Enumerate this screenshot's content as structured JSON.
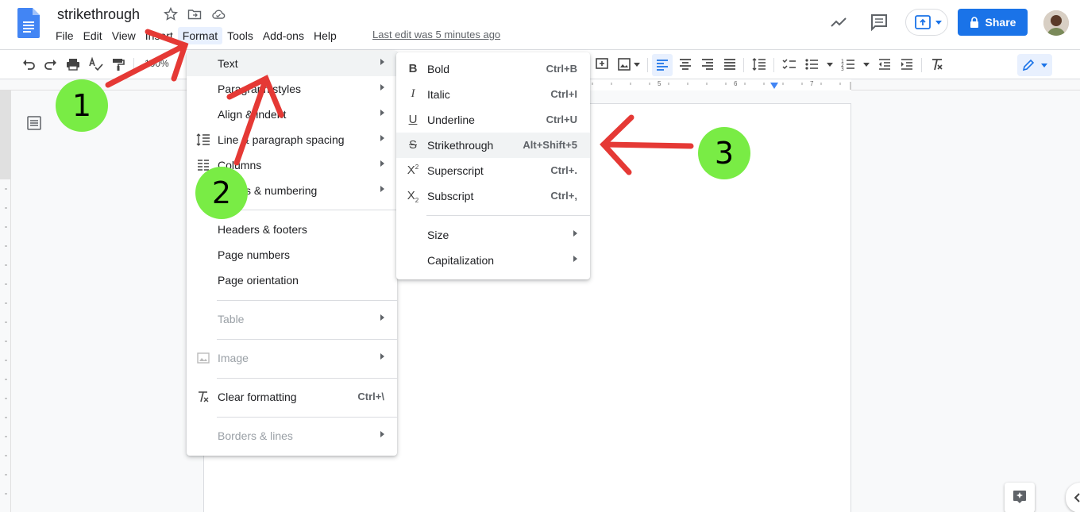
{
  "document": {
    "title": "strikethrough",
    "last_edit": "Last edit was 5 minutes ago"
  },
  "menubar": [
    "File",
    "Edit",
    "View",
    "Insert",
    "Format",
    "Tools",
    "Add-ons",
    "Help"
  ],
  "header": {
    "share_label": "Share"
  },
  "toolbar": {
    "zoom": "100%"
  },
  "ruler": [
    "5",
    "6",
    "7"
  ],
  "format_menu": {
    "text": "Text",
    "paragraph_styles": "Paragraph styles",
    "align_indent": "Align & indent",
    "line_spacing": "Line & paragraph spacing",
    "columns": "Columns",
    "bullets": "Bullets & numbering",
    "headers_footers": "Headers & footers",
    "page_numbers": "Page numbers",
    "page_orientation": "Page orientation",
    "table": "Table",
    "image": "Image",
    "clear_formatting": "Clear formatting",
    "clear_formatting_shortcut": "Ctrl+\\",
    "borders_lines": "Borders & lines"
  },
  "text_submenu": {
    "bold": "Bold",
    "bold_sc": "Ctrl+B",
    "italic": "Italic",
    "italic_sc": "Ctrl+I",
    "underline": "Underline",
    "underline_sc": "Ctrl+U",
    "strikethrough": "Strikethrough",
    "strikethrough_sc": "Alt+Shift+5",
    "superscript": "Superscript",
    "superscript_sc": "Ctrl+.",
    "subscript": "Subscript",
    "subscript_sc": "Ctrl+,",
    "size": "Size",
    "capitalization": "Capitalization"
  },
  "annotations": {
    "step1": "1",
    "step2": "2",
    "step3": "3",
    "color_arrow": "#e53935",
    "color_badge": "#79ec45"
  },
  "colors": {
    "accent": "#1a73e8",
    "menu_highlight": "#f1f3f4"
  }
}
